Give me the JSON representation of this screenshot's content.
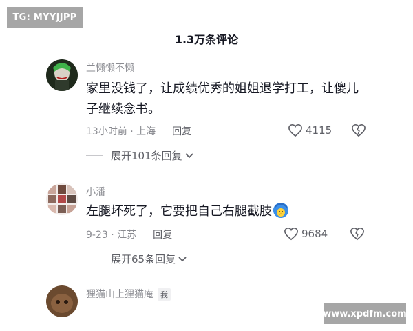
{
  "watermarks": {
    "top_left": "TG: MYYJJPP",
    "bottom_right": "www.xpdfm.com"
  },
  "header": {
    "title": "1.3万条评论"
  },
  "comments": [
    {
      "username": "兰懒懒不懒",
      "text": "家里没钱了，让成绩优秀的姐姐退学打工，让傻儿子继续念书。",
      "time_location": "13小时前 · 上海",
      "reply_label": "回复",
      "likes": "4115",
      "expand_label": "展开101条回复"
    },
    {
      "username": "小潘",
      "text": "左腿坏死了，它要把自己右腿截肢",
      "emoji_icon": "crying-face-emoji",
      "time_location": "9-23 · 江苏",
      "reply_label": "回复",
      "likes": "9684",
      "expand_label": "展开65条回复"
    },
    {
      "username": "狸猫山上狸猫庵",
      "badge": "我"
    }
  ],
  "colors": {
    "text_primary": "#161823",
    "text_secondary": "#8a8b91",
    "watermark_bg": "#a6a6a6"
  }
}
